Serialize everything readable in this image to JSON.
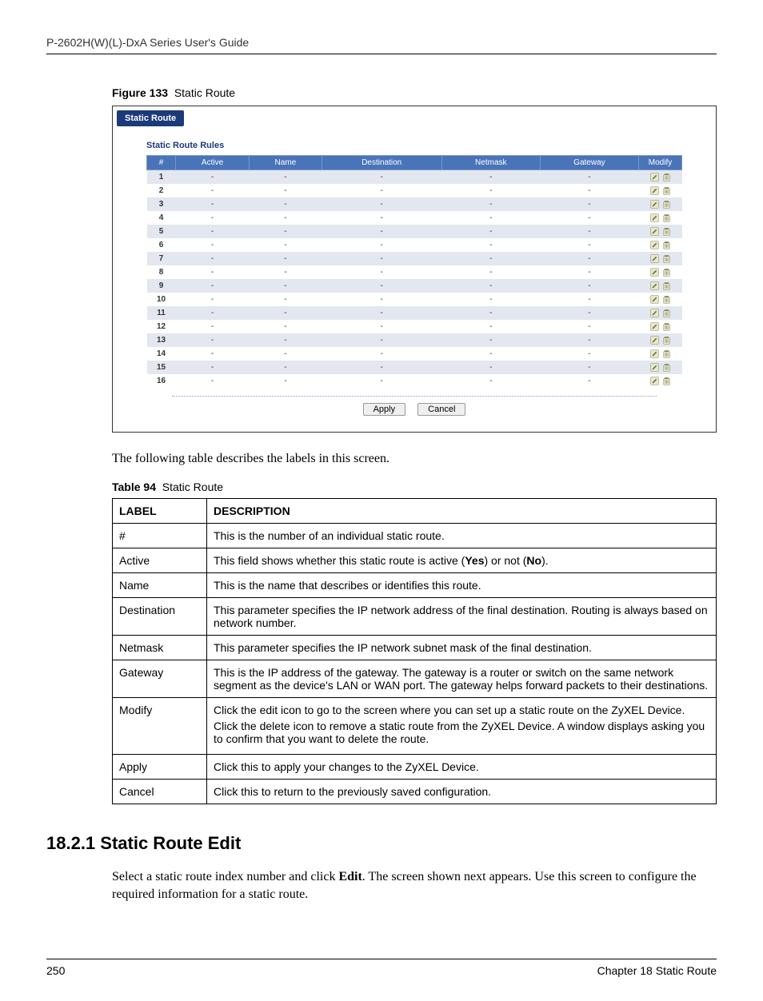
{
  "header": {
    "guide_title": "P-2602H(W)(L)-DxA Series User's Guide"
  },
  "figure": {
    "label": "Figure 133",
    "title": "Static Route"
  },
  "shot": {
    "titlebar": "Static Route",
    "subtitle": "Static Route Rules",
    "headers": {
      "num": "#",
      "active": "Active",
      "name": "Name",
      "destination": "Destination",
      "netmask": "Netmask",
      "gateway": "Gateway",
      "modify": "Modify"
    },
    "rows": [
      {
        "idx": "1",
        "active": "-",
        "name": "-",
        "destination": "-",
        "netmask": "-",
        "gateway": "-"
      },
      {
        "idx": "2",
        "active": "-",
        "name": "-",
        "destination": "-",
        "netmask": "-",
        "gateway": "-"
      },
      {
        "idx": "3",
        "active": "-",
        "name": "-",
        "destination": "-",
        "netmask": "-",
        "gateway": "-"
      },
      {
        "idx": "4",
        "active": "-",
        "name": "-",
        "destination": "-",
        "netmask": "-",
        "gateway": "-"
      },
      {
        "idx": "5",
        "active": "-",
        "name": "-",
        "destination": "-",
        "netmask": "-",
        "gateway": "-"
      },
      {
        "idx": "6",
        "active": "-",
        "name": "-",
        "destination": "-",
        "netmask": "-",
        "gateway": "-"
      },
      {
        "idx": "7",
        "active": "-",
        "name": "-",
        "destination": "-",
        "netmask": "-",
        "gateway": "-"
      },
      {
        "idx": "8",
        "active": "-",
        "name": "-",
        "destination": "-",
        "netmask": "-",
        "gateway": "-"
      },
      {
        "idx": "9",
        "active": "-",
        "name": "-",
        "destination": "-",
        "netmask": "-",
        "gateway": "-"
      },
      {
        "idx": "10",
        "active": "-",
        "name": "-",
        "destination": "-",
        "netmask": "-",
        "gateway": "-"
      },
      {
        "idx": "11",
        "active": "-",
        "name": "-",
        "destination": "-",
        "netmask": "-",
        "gateway": "-"
      },
      {
        "idx": "12",
        "active": "-",
        "name": "-",
        "destination": "-",
        "netmask": "-",
        "gateway": "-"
      },
      {
        "idx": "13",
        "active": "-",
        "name": "-",
        "destination": "-",
        "netmask": "-",
        "gateway": "-"
      },
      {
        "idx": "14",
        "active": "-",
        "name": "-",
        "destination": "-",
        "netmask": "-",
        "gateway": "-"
      },
      {
        "idx": "15",
        "active": "-",
        "name": "-",
        "destination": "-",
        "netmask": "-",
        "gateway": "-"
      },
      {
        "idx": "16",
        "active": "-",
        "name": "-",
        "destination": "-",
        "netmask": "-",
        "gateway": "-"
      }
    ],
    "buttons": {
      "apply": "Apply",
      "cancel": "Cancel"
    }
  },
  "intro_text": "The following table describes the labels in this screen.",
  "table": {
    "label": "Table 94",
    "title": "Static Route",
    "head_label": "LABEL",
    "head_desc": "DESCRIPTION",
    "rows": [
      {
        "label": "#",
        "desc": "This is the number of an individual static route."
      },
      {
        "label": "Active",
        "desc": "This field shows whether this static route is active (Yes) or not (No)."
      },
      {
        "label": "Name",
        "desc": "This is the name that describes or identifies this route."
      },
      {
        "label": "Destination",
        "desc": "This parameter specifies the IP network address of the final destination. Routing is always based on network number."
      },
      {
        "label": "Netmask",
        "desc": "This parameter specifies the IP network subnet mask of the final destination."
      },
      {
        "label": "Gateway",
        "desc": "This is the IP address of the gateway. The gateway is a router or switch on the same network segment as the device's LAN or WAN port. The gateway helps forward packets to their destinations."
      },
      {
        "label": "Modify",
        "desc": "Click the edit icon to go to the screen where you can set up a static route on the ZyXEL Device.\nClick the delete icon to remove a static route from the ZyXEL Device. A window displays asking you to confirm that you want to delete the route."
      },
      {
        "label": "Apply",
        "desc": "Click this to apply your changes to the ZyXEL Device."
      },
      {
        "label": "Cancel",
        "desc": "Click this to return to the previously saved configuration."
      }
    ]
  },
  "section": {
    "number_title": "18.2.1  Static Route Edit",
    "para": "Select a static route index number and click Edit. The screen shown next appears. Use this screen to configure the required information for a static route."
  },
  "footer": {
    "page": "250",
    "chapter": "Chapter 18 Static Route"
  }
}
